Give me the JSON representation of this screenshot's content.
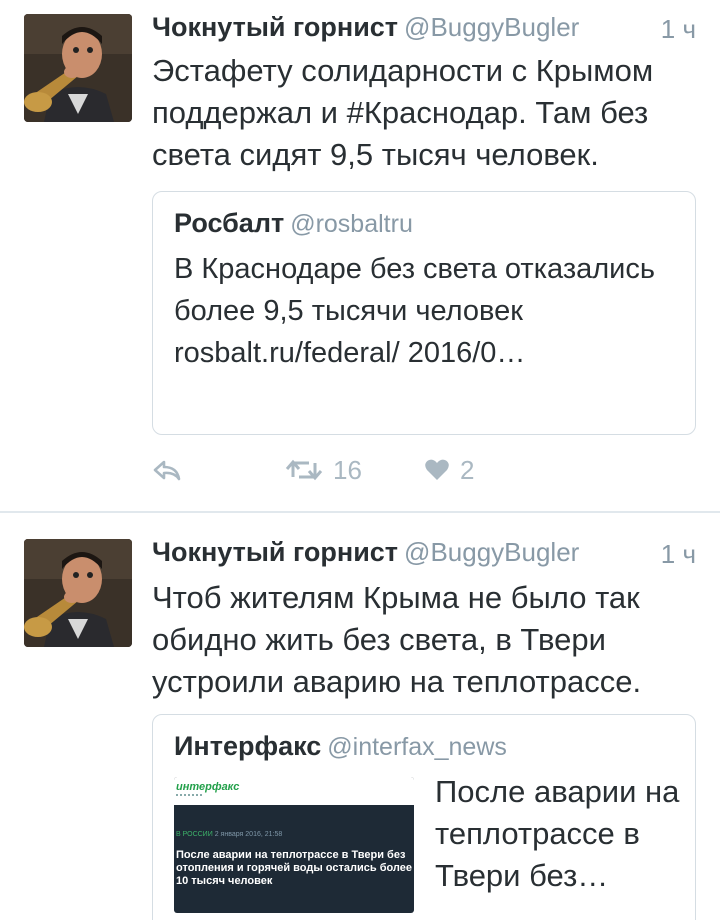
{
  "tweets": [
    {
      "display_name": "Чокнутый горнист",
      "handle": "@BuggyBugler",
      "time": "1 ч",
      "text": "Эстафету солидарности с Крымом поддержал и #Краснодар. Там без света сидят 9,5 тысяч человек.",
      "quote": {
        "display_name": "Росбалт",
        "handle": "@rosbaltru",
        "text": "В Краснодаре без света отказались более 9,5 тысячи человек  rosbalt.ru/federal/ 2016/0…"
      },
      "actions": {
        "reply_icon": "reply-icon",
        "retweet_icon": "retweet-icon",
        "retweet_count": "16",
        "like_icon": "heart-icon",
        "like_count": "2"
      }
    },
    {
      "display_name": "Чокнутый горнист",
      "handle": "@BuggyBugler",
      "time": "1 ч",
      "text": "Чтоб жителям Крыма не было так обидно жить без света, в Твери устроили аварию на теплотрассе.",
      "quote": {
        "display_name": "Интерфакс",
        "handle": "@interfax_news",
        "card_text": "После аварии на теплотрассе в Твери без…",
        "image": {
          "logo": "интерфакс",
          "tag": "В РОССИИ",
          "date": "2 января 2016, 21:58",
          "headline": "После аварии на теплотрассе в Твери без отопления и горячей воды остались более 10 тысяч человек"
        }
      }
    }
  ],
  "colors": {
    "text": "#292f33",
    "secondary": "#8899a6",
    "action": "#aab8c2",
    "border": "#e1e8ed"
  }
}
